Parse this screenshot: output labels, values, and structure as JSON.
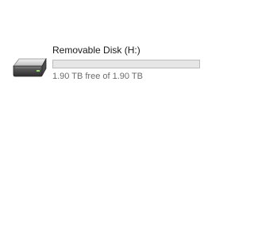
{
  "drive": {
    "name": "Removable Disk (H:)",
    "free_text": "1.90 TB free of 1.90 TB",
    "used_fraction": 0,
    "icon": "removable-drive-icon",
    "bar_fill_color": "#26a0da",
    "bar_track_color": "#e6e6e6"
  }
}
